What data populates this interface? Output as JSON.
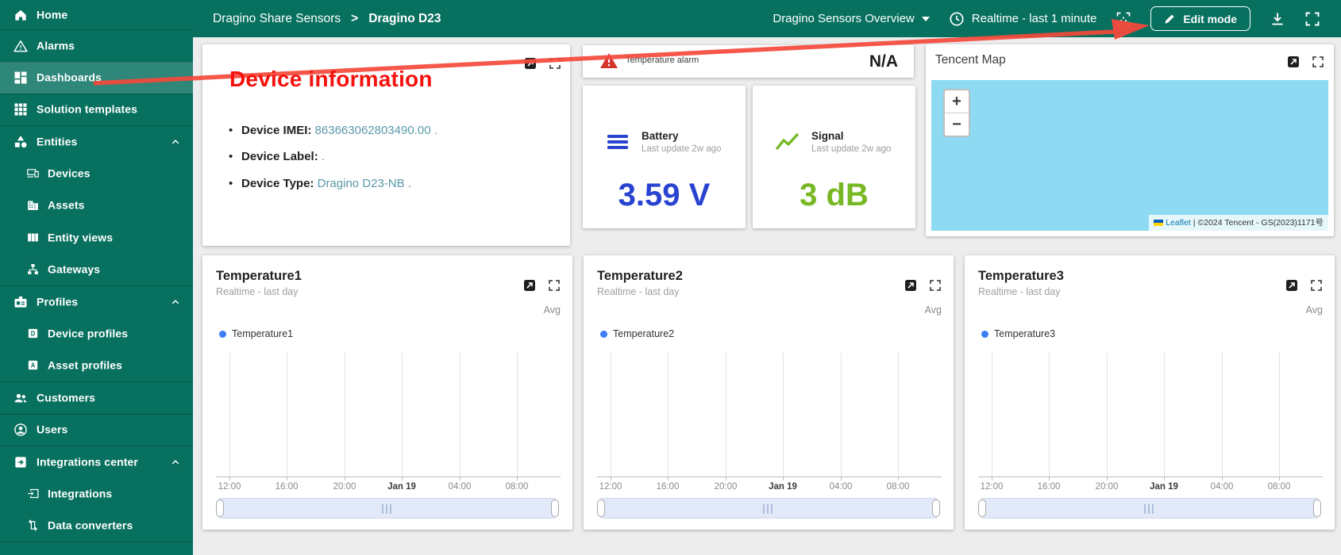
{
  "theme": {
    "sidebar_bg": "#07705f",
    "selected_overlay": "rgba(255,255,255,0.16)",
    "annotation_red": "#f3120e",
    "battery_blue": "#2743d0",
    "signal_green": "#77b824",
    "map_water": "#8edaf2",
    "legend_dot_blue": "#3d7df5",
    "alarm_red": "#d4342c"
  },
  "sidebar": {
    "items": [
      {
        "label": "Home"
      },
      {
        "label": "Alarms"
      },
      {
        "label": "Dashboards",
        "selected": true
      },
      {
        "label": "Solution templates"
      },
      {
        "label": "Entities",
        "expanded": true
      },
      {
        "label": "Devices",
        "child": true
      },
      {
        "label": "Assets",
        "child": true
      },
      {
        "label": "Entity views",
        "child": true
      },
      {
        "label": "Gateways",
        "child": true
      },
      {
        "label": "Profiles",
        "expanded": true
      },
      {
        "label": "Device profiles",
        "child": true
      },
      {
        "label": "Asset profiles",
        "child": true
      },
      {
        "label": "Customers"
      },
      {
        "label": "Users"
      },
      {
        "label": "Integrations center",
        "expanded": true
      },
      {
        "label": "Integrations",
        "child": true
      },
      {
        "label": "Data converters",
        "child": true
      }
    ]
  },
  "header": {
    "breadcrumb_parent": "Dragino Share Sensors",
    "breadcrumb_separator": ">",
    "breadcrumb_current": "Dragino D23",
    "dashboard_select": "Dragino Sensors Overview",
    "time_window": "Realtime - last 1 minute",
    "edit_mode_label": "Edit mode"
  },
  "annotation": {
    "label": "Device information"
  },
  "device_info": {
    "rows": [
      {
        "label": "Device IMEI:",
        "value": "863663062803490.00",
        "suffix": " ."
      },
      {
        "label": "Device Label:",
        "value": "",
        "suffix": " ."
      },
      {
        "label": "Device Type:",
        "value": "Dragino D23-NB",
        "suffix": " ."
      }
    ]
  },
  "alarm_card": {
    "title": "Temperature alarm",
    "value": "N/A"
  },
  "battery_card": {
    "title": "Battery",
    "subtitle": "Last update 2w ago",
    "value": "3.59 V"
  },
  "signal_card": {
    "title": "Signal",
    "subtitle": "Last update 2w ago",
    "value": "3 dB"
  },
  "map_card": {
    "title": "Tencent Map",
    "zoom_in": "+",
    "zoom_out": "−",
    "attribution": {
      "leaflet": "Leaflet",
      "separator": "|",
      "copyright": "©2024 Tencent - GS(2023)1171号"
    }
  },
  "charts": [
    {
      "title": "Temperature1",
      "subtitle": "Realtime - last day",
      "aggregation": "Avg",
      "legend": "Temperature1",
      "x_ticks": [
        "12:00",
        "16:00",
        "20:00",
        "Jan 19",
        "04:00",
        "08:00"
      ],
      "series": []
    },
    {
      "title": "Temperature2",
      "subtitle": "Realtime - last day",
      "aggregation": "Avg",
      "legend": "Temperature2",
      "x_ticks": [
        "12:00",
        "16:00",
        "20:00",
        "Jan 19",
        "04:00",
        "08:00"
      ],
      "series": []
    },
    {
      "title": "Temperature3",
      "subtitle": "Realtime - last day",
      "aggregation": "Avg",
      "legend": "Temperature3",
      "x_ticks": [
        "12:00",
        "16:00",
        "20:00",
        "Jan 19",
        "04:00",
        "08:00"
      ],
      "series": []
    }
  ]
}
